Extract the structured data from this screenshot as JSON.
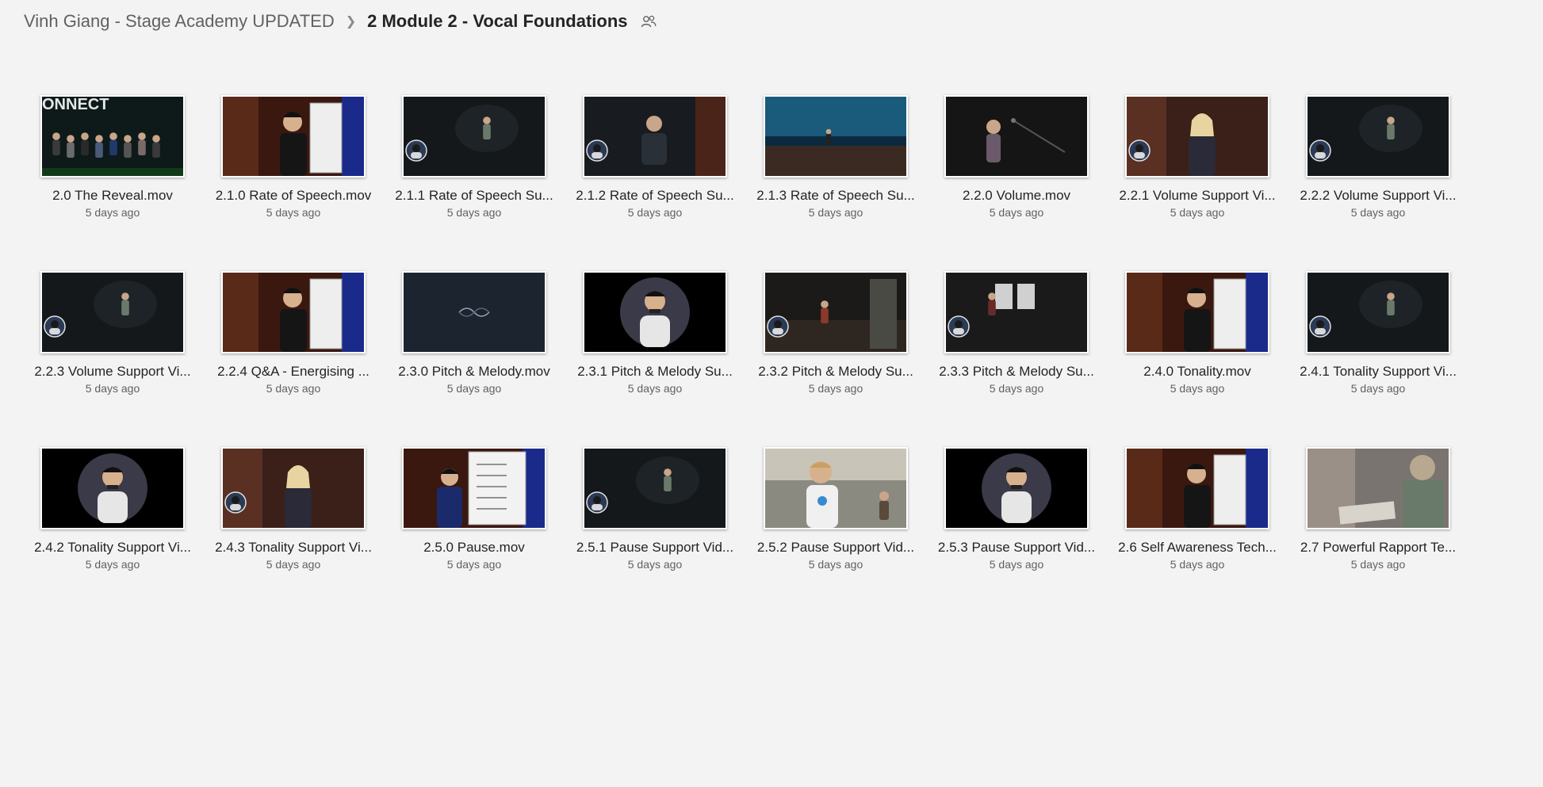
{
  "breadcrumb": {
    "parent": "Vinh Giang - Stage Academy UPDATED",
    "current": "2 Module 2 - Vocal Foundations",
    "shared_icon": "people-icon"
  },
  "files": [
    {
      "name": "2.0 The Reveal.mov",
      "modified": "5 days ago",
      "thumb": "stage-group"
    },
    {
      "name": "2.1.0 Rate of Speech.mov",
      "modified": "5 days ago",
      "thumb": "whiteboard-host"
    },
    {
      "name": "2.1.1 Rate of Speech Su...",
      "modified": "5 days ago",
      "thumb": "dark-stage-avatar"
    },
    {
      "name": "2.1.2 Rate of Speech Su...",
      "modified": "5 days ago",
      "thumb": "seated-speaker-avatar"
    },
    {
      "name": "2.1.3 Rate of Speech Su...",
      "modified": "5 days ago",
      "thumb": "blue-stage"
    },
    {
      "name": "2.2.0 Volume.mov",
      "modified": "5 days ago",
      "thumb": "podium-speaker"
    },
    {
      "name": "2.2.1 Volume Support Vi...",
      "modified": "5 days ago",
      "thumb": "interview-avatar"
    },
    {
      "name": "2.2.2 Volume Support Vi...",
      "modified": "5 days ago",
      "thumb": "dark-stage-avatar"
    },
    {
      "name": "2.2.3 Volume Support Vi...",
      "modified": "5 days ago",
      "thumb": "dark-stage-avatar"
    },
    {
      "name": "2.2.4 Q&A - Energising ...",
      "modified": "5 days ago",
      "thumb": "whiteboard-host"
    },
    {
      "name": "2.3.0 Pitch & Melody.mov",
      "modified": "5 days ago",
      "thumb": "title-card"
    },
    {
      "name": "2.3.1 Pitch & Melody Su...",
      "modified": "5 days ago",
      "thumb": "circle-portrait"
    },
    {
      "name": "2.3.2 Pitch & Melody Su...",
      "modified": "5 days ago",
      "thumb": "banner-stage-avatar"
    },
    {
      "name": "2.3.3 Pitch & Melody Su...",
      "modified": "5 days ago",
      "thumb": "boards-stage-avatar"
    },
    {
      "name": "2.4.0 Tonality.mov",
      "modified": "5 days ago",
      "thumb": "whiteboard-host"
    },
    {
      "name": "2.4.1 Tonality Support Vi...",
      "modified": "5 days ago",
      "thumb": "dark-stage-avatar"
    },
    {
      "name": "2.4.2 Tonality Support Vi...",
      "modified": "5 days ago",
      "thumb": "circle-portrait"
    },
    {
      "name": "2.4.3 Tonality Support Vi...",
      "modified": "5 days ago",
      "thumb": "interview-avatar"
    },
    {
      "name": "2.5.0 Pause.mov",
      "modified": "5 days ago",
      "thumb": "whiteboard-list"
    },
    {
      "name": "2.5.1 Pause Support Vid...",
      "modified": "5 days ago",
      "thumb": "dark-stage-avatar"
    },
    {
      "name": "2.5.2 Pause Support Vid...",
      "modified": "5 days ago",
      "thumb": "outdoor-crowd"
    },
    {
      "name": "2.5.3 Pause Support Vid...",
      "modified": "5 days ago",
      "thumb": "circle-portrait"
    },
    {
      "name": "2.6 Self Awareness Tech...",
      "modified": "5 days ago",
      "thumb": "whiteboard-host"
    },
    {
      "name": "2.7 Powerful Rapport Te...",
      "modified": "5 days ago",
      "thumb": "cards-table"
    }
  ]
}
